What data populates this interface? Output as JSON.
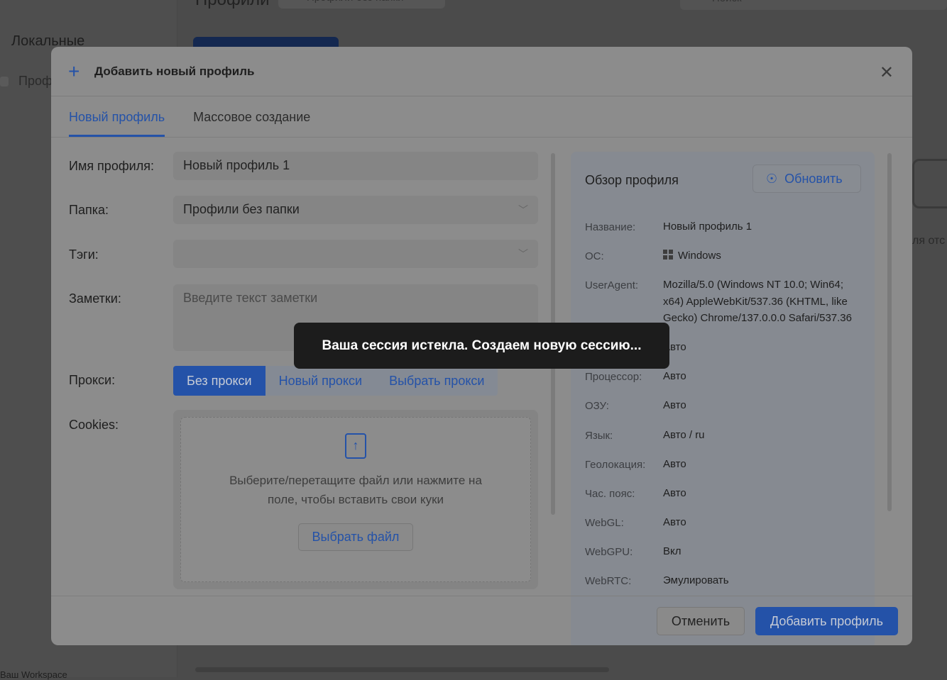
{
  "background": {
    "title": "Профили",
    "folder": "Профили без папки",
    "search_placeholder": "Поиск",
    "sidebar_section": "Локальные",
    "sidebar_item": "Проф",
    "workspace": "Ваш Workspace",
    "side_text": "ля отс"
  },
  "modal": {
    "title": "Добавить новый профиль",
    "tabs": [
      "Новый профиль",
      "Массовое создание"
    ],
    "form": {
      "name_label": "Имя профиля:",
      "name_value": "Новый профиль 1",
      "folder_label": "Папка:",
      "folder_value": "Профили без папки",
      "tags_label": "Тэги:",
      "tags_value": "",
      "notes_label": "Заметки:",
      "notes_placeholder": "Введите текст заметки",
      "proxy_label": "Прокси:",
      "proxy_options": [
        "Без прокси",
        "Новый прокси",
        "Выбрать прокси"
      ],
      "cookies_label": "Cookies:",
      "cookies_hint_1": "Выберите/перетащите файл или нажмите на",
      "cookies_hint_2": "поле, чтобы вставить свои куки",
      "choose_file": "Выбрать файл"
    },
    "overview": {
      "title": "Обзор профиля",
      "refresh": "Обновить",
      "rows": [
        {
          "k": "Название:",
          "v": "Новый профиль 1"
        },
        {
          "k": "ОС:",
          "v": "Windows"
        },
        {
          "k": "UserAgent:",
          "v": "Mozilla/5.0 (Windows NT 10.0; Win64; x64) AppleWebKit/537.36 (KHTML, like Gecko) Chrome/137.0.0.0 Safari/537.36"
        },
        {
          "k": "",
          "v": "Авто"
        },
        {
          "k": "Процессор:",
          "v": "Авто"
        },
        {
          "k": "ОЗУ:",
          "v": "Авто"
        },
        {
          "k": "Язык:",
          "v": "Авто / ru"
        },
        {
          "k": "Геолокация:",
          "v": "Авто"
        },
        {
          "k": "Час. пояс:",
          "v": "Авто"
        },
        {
          "k": "WebGL:",
          "v": "Авто"
        },
        {
          "k": "WebGPU:",
          "v": "Вкл"
        },
        {
          "k": "WebRTC:",
          "v": "Эмулировать"
        }
      ]
    },
    "cancel": "Отменить",
    "submit": "Добавить профиль"
  },
  "toast": "Ваша сессия истекла. Создаем новую сессию..."
}
